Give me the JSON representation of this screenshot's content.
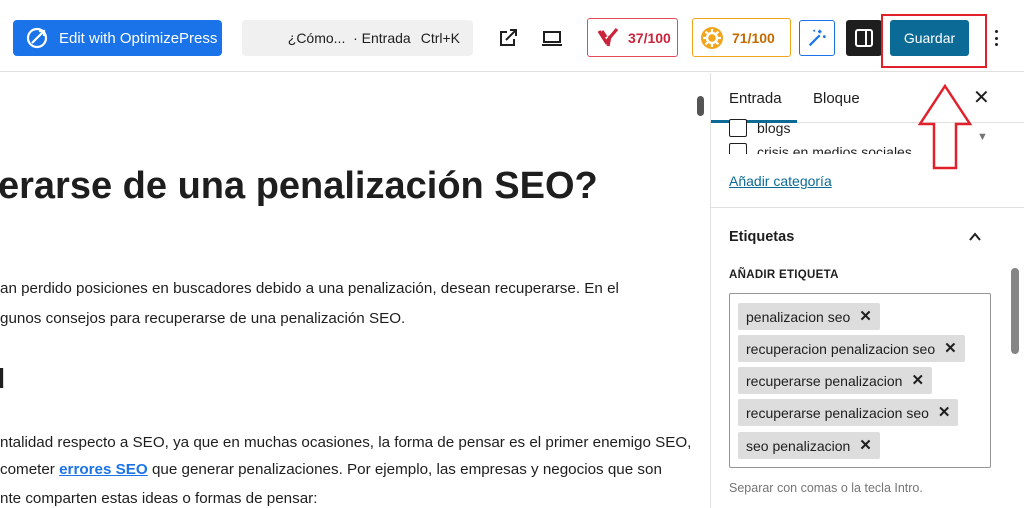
{
  "toolbar": {
    "optimize_label": "Edit with OptimizePress",
    "command_text": "¿Cómo...  · Entrada",
    "command_shortcut": "Ctrl+K",
    "seo_score": "37/100",
    "readability_score": "71/100",
    "save_label": "Guardar"
  },
  "editor": {
    "title": "erarse de una penalización SEO?",
    "paragraph1_line1": "an perdido posiciones en buscadores debido a una penalización, desean recuperarse. En el",
    "paragraph1_line2": "gunos consejos para recuperarse de una penalización SEO.",
    "heading2": "d",
    "paragraph2_line1": "ntalidad respecto a SEO, ya que en muchas ocasiones, la forma de pensar es el primer enemigo SEO,",
    "paragraph2_line2_pre": " cometer ",
    "paragraph2_link": "errores SEO",
    "paragraph2_line2_post": " que generar penalizaciones. Por ejemplo, las empresas y negocios que son",
    "paragraph2_line3": "nte comparten estas ideas o formas de pensar:"
  },
  "sidebar": {
    "tab_post": "Entrada",
    "tab_block": "Bloque",
    "close": "✕",
    "categories": [
      "blogs",
      "crisis en medios sociales"
    ],
    "add_category": "Añadir categoría",
    "tags_section_title": "Etiquetas",
    "add_tag_label": "AÑADIR ETIQUETA",
    "tags": [
      "penalizacion seo",
      "recuperacion penalizacion seo",
      "recuperarse penalizacion",
      "recuperarse penalizacion seo",
      "seo penalizacion"
    ],
    "tag_remove": "✕",
    "help_text": "Separar con comas o la tecla Intro."
  },
  "colors": {
    "optimize_blue": "#1a73e8",
    "save_button": "#0b6b96",
    "highlight_red": "#e0202a",
    "seo_red": "#e4485a",
    "readability_orange": "#f2a51a"
  },
  "icons": {
    "optimize": "optimizepress-logo-icon",
    "external": "external-link-icon",
    "preview": "laptop-preview-icon",
    "seo": "yoast-seo-icon",
    "readability": "readability-gear-icon",
    "ai": "magic-wand-icon",
    "sidebar": "sidebar-toggle-icon",
    "more": "more-vertical-icon"
  }
}
